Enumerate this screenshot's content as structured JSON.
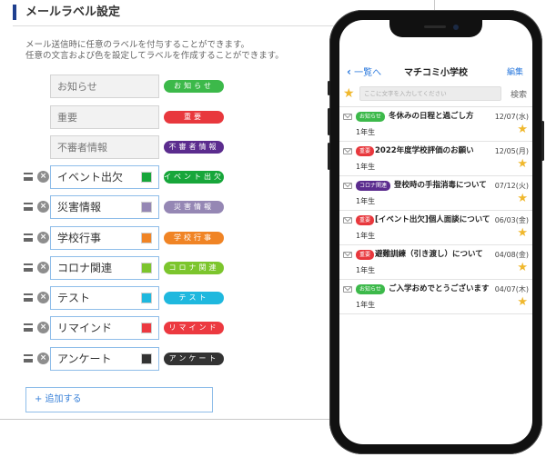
{
  "settings": {
    "title": "メールラベル設定",
    "description_line1": "メール送信時に任意のラベルを付与することができます。",
    "description_line2": "任意の文言および色を設定してラベルを作成することができます。",
    "default_labels": [
      {
        "name": "お知らせ",
        "badge": "お知らせ",
        "color": "#3cb94a"
      },
      {
        "name": "重要",
        "badge": "重要",
        "color": "#e8383d"
      },
      {
        "name": "不審者情報",
        "badge": "不審者情報",
        "color": "#5b2c8e"
      }
    ],
    "custom_labels": [
      {
        "name": "イベント出欠",
        "badge": "イベント出欠",
        "color": "#17a63a"
      },
      {
        "name": "災害情報",
        "badge": "災害情報",
        "color": "#9587b4"
      },
      {
        "name": "学校行事",
        "badge": "学校行事",
        "color": "#f08425"
      },
      {
        "name": "コロナ関連",
        "badge": "コロナ関連",
        "color": "#7cc52d"
      },
      {
        "name": "テスト",
        "badge": "テスト",
        "color": "#1fb8de"
      },
      {
        "name": "リマインド",
        "badge": "リマインド",
        "color": "#ec3940"
      },
      {
        "name": "アンケート",
        "badge": "アンケート",
        "color": "#333333"
      }
    ],
    "add_button": "+ 追加する"
  },
  "phone": {
    "back_label": "一覧へ",
    "title": "マチコミ小学校",
    "edit_label": "編集",
    "search_placeholder": "ここに文字を入力してください",
    "search_button": "検索",
    "messages": [
      {
        "badge": "お知らせ",
        "badge_color": "#3cb94a",
        "title": "冬休みの日程と過ごし方",
        "date": "12/07(水)",
        "class": "1年生"
      },
      {
        "badge": "重要",
        "badge_color": "#e8383d",
        "title": "2022年度学校評価のお願い",
        "date": "12/05(月)",
        "class": "1年生"
      },
      {
        "badge": "コロナ関連",
        "badge_color": "#5b2c8e",
        "title": "登校時の手指消毒について",
        "date": "07/12(火)",
        "class": "1年生"
      },
      {
        "badge": "重要",
        "badge_color": "#e8383d",
        "title": "[イベント出欠]個人面談について",
        "date": "06/03(金)",
        "class": "1年生"
      },
      {
        "badge": "重要",
        "badge_color": "#e8383d",
        "title": "避難訓練（引き渡し）について",
        "date": "04/08(金)",
        "class": "1年生"
      },
      {
        "badge": "お知らせ",
        "badge_color": "#3cb94a",
        "title": "ご入学おめでとうございます",
        "date": "04/07(木)",
        "class": "1年生"
      }
    ]
  }
}
